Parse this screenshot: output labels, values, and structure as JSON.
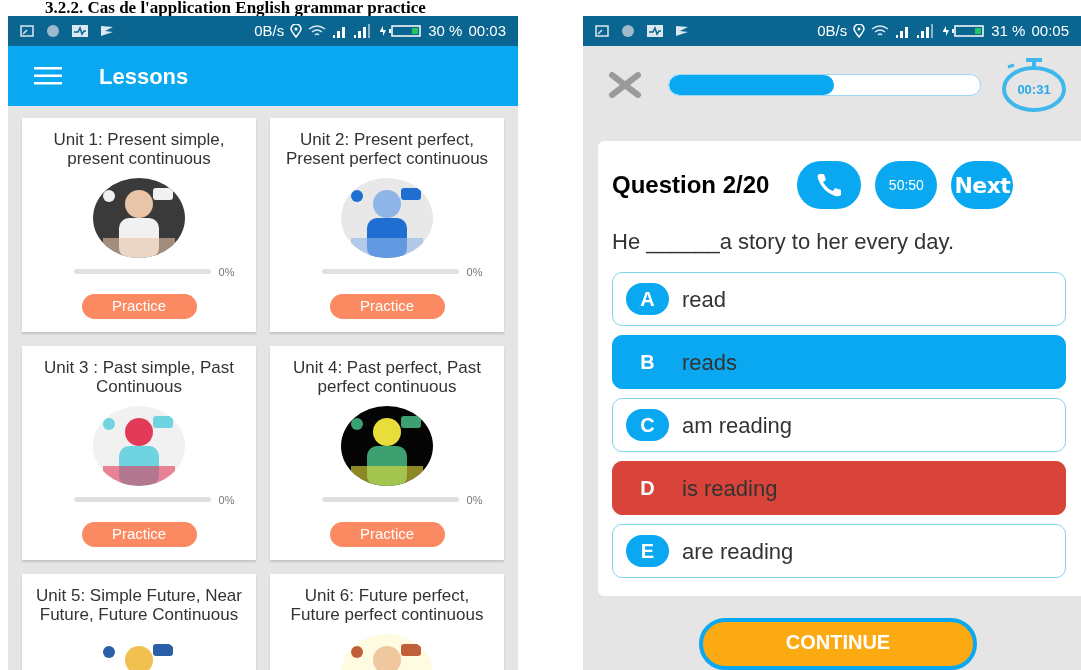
{
  "caption": "3.2.2.   Cas de l'application English grammar practice",
  "phones": [
    {
      "status_bar": {
        "speed": "0B/s",
        "battery": "30 %",
        "time": "00:03"
      }
    },
    {
      "status_bar": {
        "speed": "0B/s",
        "battery": "31 %",
        "time": "00:05"
      }
    }
  ],
  "lessons": {
    "title": "Lessons",
    "units": [
      {
        "title": "Unit 1: Present simple, present continuous",
        "level": 0,
        "reading": "0%",
        "button": "Practice"
      },
      {
        "title": "Unit 2: Present perfect, Present perfect continuous",
        "level": 0,
        "reading": "0%",
        "button": "Practice"
      },
      {
        "title": "Unit 3 : Past simple, Past Continuous",
        "level": 0,
        "reading": "0%",
        "button": "Practice"
      },
      {
        "title": "Unit 4: Past perfect, Past perfect continuous",
        "level": 0,
        "reading": "0%",
        "button": "Practice"
      },
      {
        "title": "Unit 5: Simple Future, Near Future, Future Continuous"
      },
      {
        "title": "Unit 6: Future perfect, Future perfect continuous"
      }
    ]
  },
  "quiz": {
    "progress": {
      "level": 0.53
    },
    "timer": "00:31",
    "question_label": "Question 2/20",
    "help_buttons": [
      {
        "kind": "phone"
      },
      {
        "kind": "text",
        "label": "50:50"
      },
      {
        "kind": "text",
        "label": "Next"
      }
    ],
    "sentence": "He ______a story to her every day.",
    "options": [
      {
        "letter": "A",
        "text": "read",
        "kind": "plain"
      },
      {
        "letter": "B",
        "text": "reads",
        "kind": "correct"
      },
      {
        "letter": "C",
        "text": "am reading",
        "kind": "plain"
      },
      {
        "letter": "D",
        "text": "is reading",
        "kind": "wrong"
      },
      {
        "letter": "E",
        "text": "are reading",
        "kind": "plain"
      }
    ],
    "continue_button": "CONTINUE"
  }
}
